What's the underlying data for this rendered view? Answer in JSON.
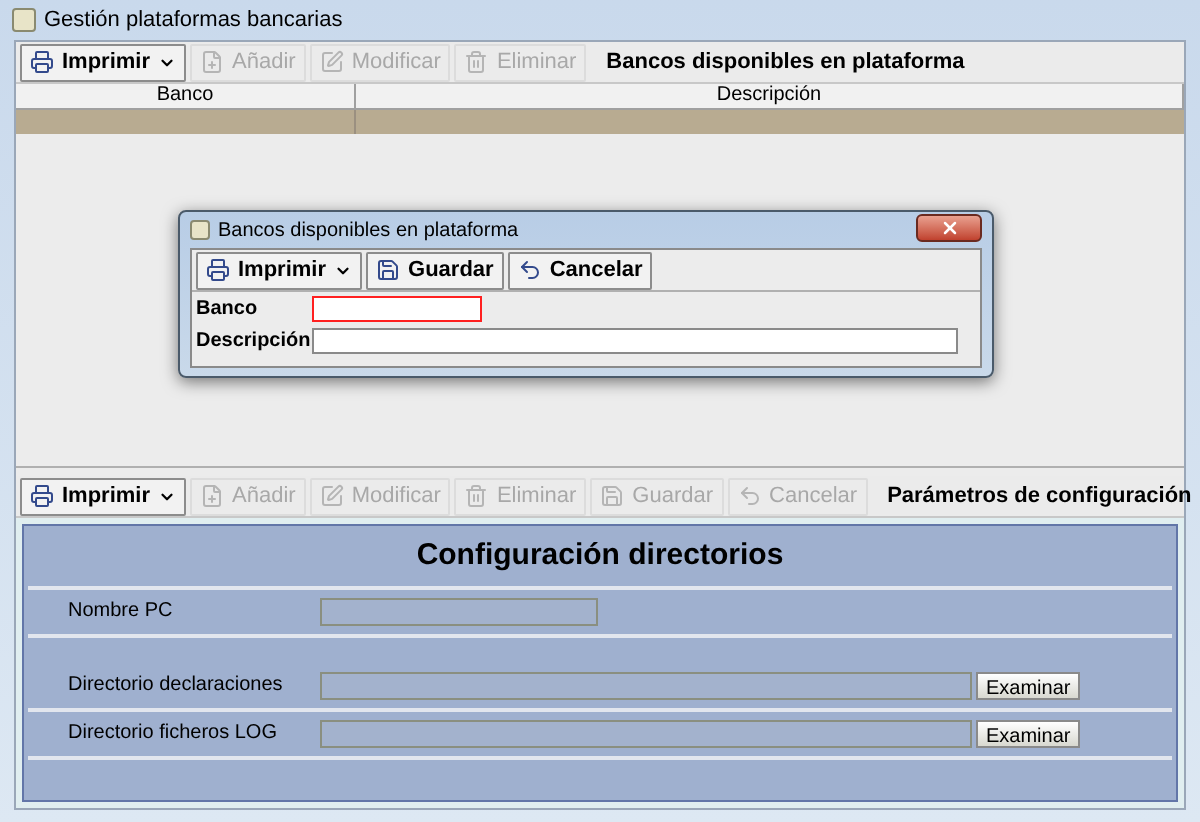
{
  "window": {
    "title": "Gestión plataformas bancarias"
  },
  "top_toolbar": {
    "buttons": [
      {
        "kind": "print",
        "label": "Imprimir",
        "menu": true,
        "disabled": false
      },
      {
        "kind": "add",
        "label": "Añadir",
        "menu": false,
        "disabled": true
      },
      {
        "kind": "edit",
        "label": "Modificar",
        "menu": false,
        "disabled": true
      },
      {
        "kind": "delete",
        "label": "Eliminar",
        "menu": false,
        "disabled": true
      }
    ],
    "title": "Bancos disponibles en plataforma"
  },
  "table": {
    "columns": [
      "Banco",
      "Descripción"
    ],
    "rows": [
      {
        "selected": true
      }
    ]
  },
  "dialog": {
    "title": "Bancos disponibles en plataforma",
    "buttons": [
      {
        "kind": "print",
        "label": "Imprimir",
        "menu": true,
        "disabled": false
      },
      {
        "kind": "save",
        "label": "Guardar",
        "menu": false,
        "disabled": false
      },
      {
        "kind": "cancel",
        "label": "Cancelar",
        "menu": false,
        "disabled": false
      }
    ],
    "fields": [
      {
        "label": "Banco",
        "error": true
      },
      {
        "label": "Descripción",
        "error": false
      }
    ]
  },
  "bottom_toolbar": {
    "buttons": [
      {
        "kind": "print",
        "label": "Imprimir",
        "menu": true,
        "disabled": false
      },
      {
        "kind": "add",
        "label": "Añadir",
        "menu": false,
        "disabled": true
      },
      {
        "kind": "edit",
        "label": "Modificar",
        "menu": false,
        "disabled": true
      },
      {
        "kind": "delete",
        "label": "Eliminar",
        "menu": false,
        "disabled": true
      },
      {
        "kind": "save",
        "label": "Guardar",
        "menu": false,
        "disabled": true
      },
      {
        "kind": "cancel",
        "label": "Cancelar",
        "menu": false,
        "disabled": true
      }
    ],
    "title": "Parámetros de configuración"
  },
  "config": {
    "title": "Configuración directorios",
    "rows": [
      {
        "label": "Nombre PC",
        "wide": false
      },
      {
        "label": "Directorio declaraciones",
        "wide": true,
        "button": "Examinar"
      },
      {
        "label": "Directorio ficheros LOG",
        "wide": true,
        "button": "Examinar"
      }
    ]
  }
}
